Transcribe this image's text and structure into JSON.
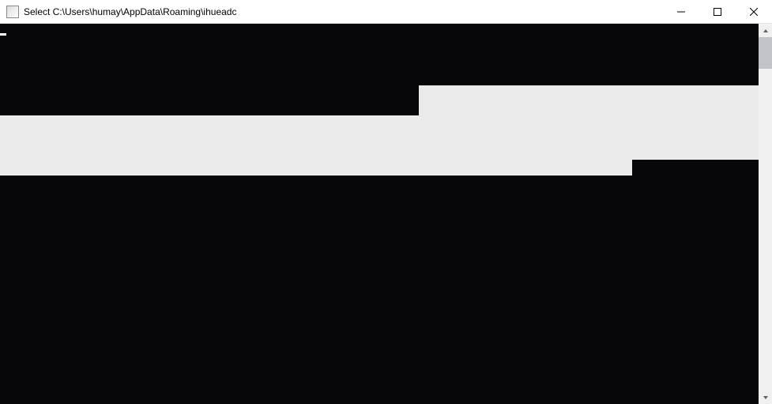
{
  "window": {
    "title": "Select C:\\Users\\humay\\AppData\\Roaming\\ihueadc"
  }
}
